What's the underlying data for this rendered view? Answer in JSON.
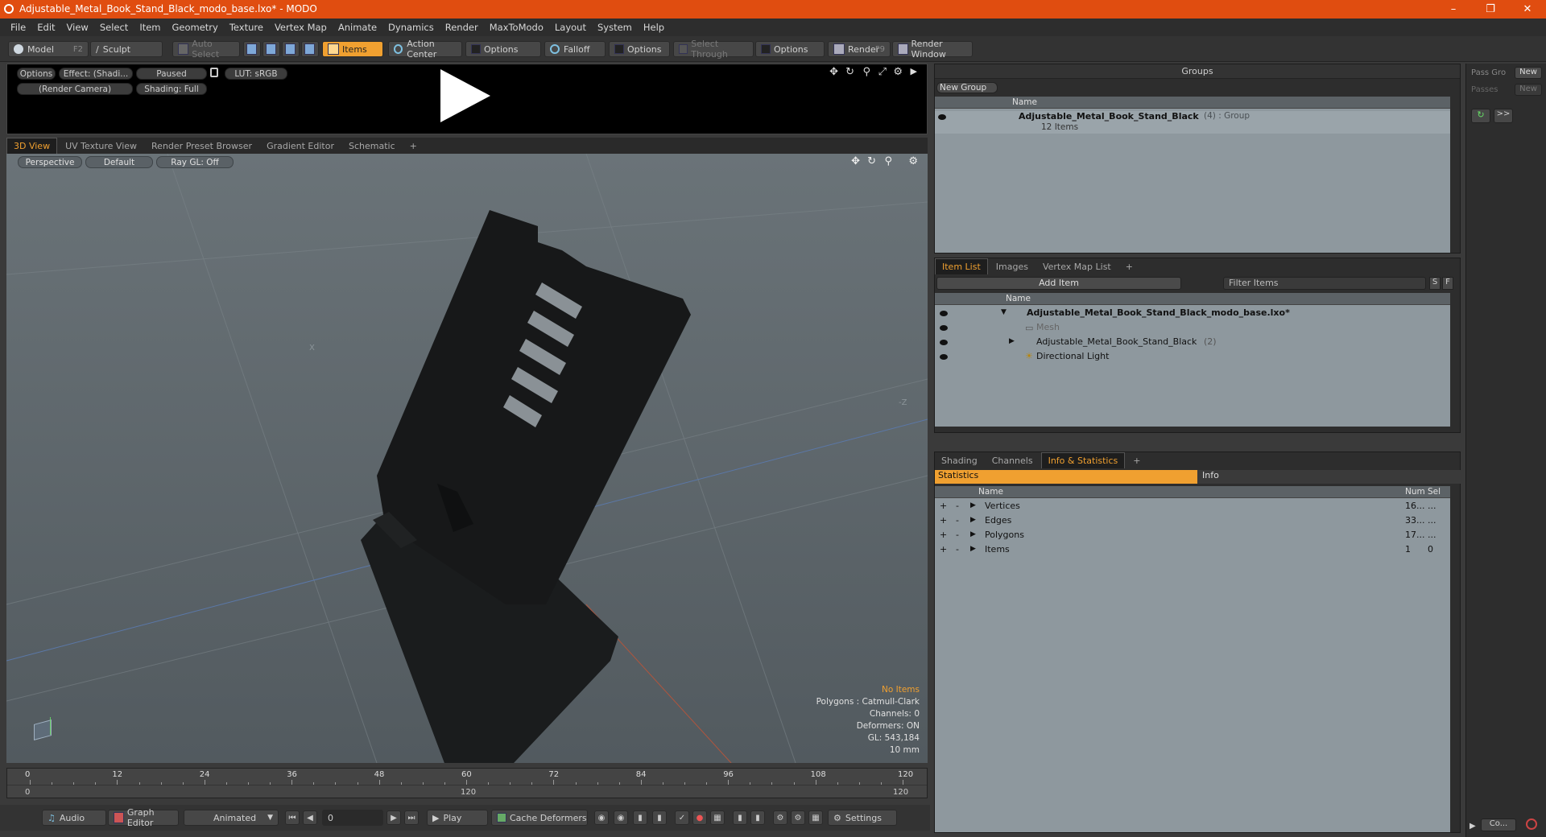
{
  "window": {
    "title": "Adjustable_Metal_Book_Stand_Black_modo_base.lxo* - MODO"
  },
  "menu": [
    "File",
    "Edit",
    "View",
    "Select",
    "Item",
    "Geometry",
    "Texture",
    "Vertex Map",
    "Animate",
    "Dynamics",
    "Render",
    "MaxToModo",
    "Layout",
    "System",
    "Help"
  ],
  "toolbar": {
    "model": "Model",
    "model_key": "F2",
    "sculpt": "Sculpt",
    "auto_select": "Auto Select",
    "items": "Items",
    "action_center": "Action Center",
    "options": "Options",
    "falloff": "Falloff",
    "select_through": "Select Through",
    "render": "Render",
    "render_key": "F9",
    "render_window": "Render Window"
  },
  "preview": {
    "options": "Options",
    "effect": "Effect: (Shadi...",
    "paused": "Paused",
    "lut": "LUT: sRGB",
    "camera": "(Render Camera)",
    "shading": "Shading: Full"
  },
  "view_tabs": [
    "3D View",
    "UV Texture View",
    "Render Preset Browser",
    "Gradient Editor",
    "Schematic",
    "+"
  ],
  "viewport": {
    "perspective": "Perspective",
    "default": "Default",
    "raygl": "Ray GL: Off",
    "hud": {
      "no_items": "No Items",
      "polygons": "Polygons : Catmull-Clark",
      "channels": "Channels: 0",
      "deformers": "Deformers: ON",
      "gl": "GL: 543,184",
      "scale": "10 mm"
    },
    "axis_x": "X",
    "axis_z": "-Z"
  },
  "timeline": {
    "ticks": [
      "0",
      "12",
      "24",
      "36",
      "48",
      "60",
      "72",
      "84",
      "96",
      "108",
      "120"
    ],
    "range_start": "0",
    "range_mid": "120",
    "range_end": "120"
  },
  "bottom": {
    "audio": "Audio",
    "graph_editor": "Graph Editor",
    "animated": "Animated",
    "frame": "0",
    "play": "Play",
    "cache": "Cache Deformers",
    "settings": "Settings"
  },
  "groups": {
    "title": "Groups",
    "new_group": "New Group",
    "col_name": "Name",
    "item_name": "Adjustable_Metal_Book_Stand_Black",
    "item_suffix": "(4) : Group",
    "item_count": "12 Items"
  },
  "item_list": {
    "tabs": [
      "Item List",
      "Images",
      "Vertex Map List",
      "+"
    ],
    "add_item": "Add Item",
    "filter": "Filter Items",
    "s": "S",
    "f": "F",
    "col_name": "Name",
    "rows": [
      {
        "label": "Adjustable_Metal_Book_Stand_Black_modo_base.lxo*",
        "suffix": ""
      },
      {
        "label": "Mesh",
        "suffix": ""
      },
      {
        "label": "Adjustable_Metal_Book_Stand_Black",
        "suffix": "(2)"
      },
      {
        "label": "Directional Light",
        "suffix": ""
      }
    ]
  },
  "stats": {
    "tabs": [
      "Shading",
      "Channels",
      "Info & Statistics",
      "+"
    ],
    "statistics": "Statistics",
    "info": "Info",
    "col_name": "Name",
    "col_num": "Num",
    "col_sel": "Sel",
    "rows": [
      {
        "name": "Vertices",
        "num": "16...",
        "sel": "..."
      },
      {
        "name": "Edges",
        "num": "33...",
        "sel": "..."
      },
      {
        "name": "Polygons",
        "num": "17...",
        "sel": "..."
      },
      {
        "name": "Items",
        "num": "1",
        "sel": "0"
      }
    ]
  },
  "right_strip": {
    "pass_groups": "Pass Gro",
    "passes": "Passes",
    "new1": "New",
    "new2": "New",
    "more": ">>",
    "co": "Co..."
  },
  "colors": {
    "accent": "#f0a030",
    "titlebar": "#e04d10"
  }
}
